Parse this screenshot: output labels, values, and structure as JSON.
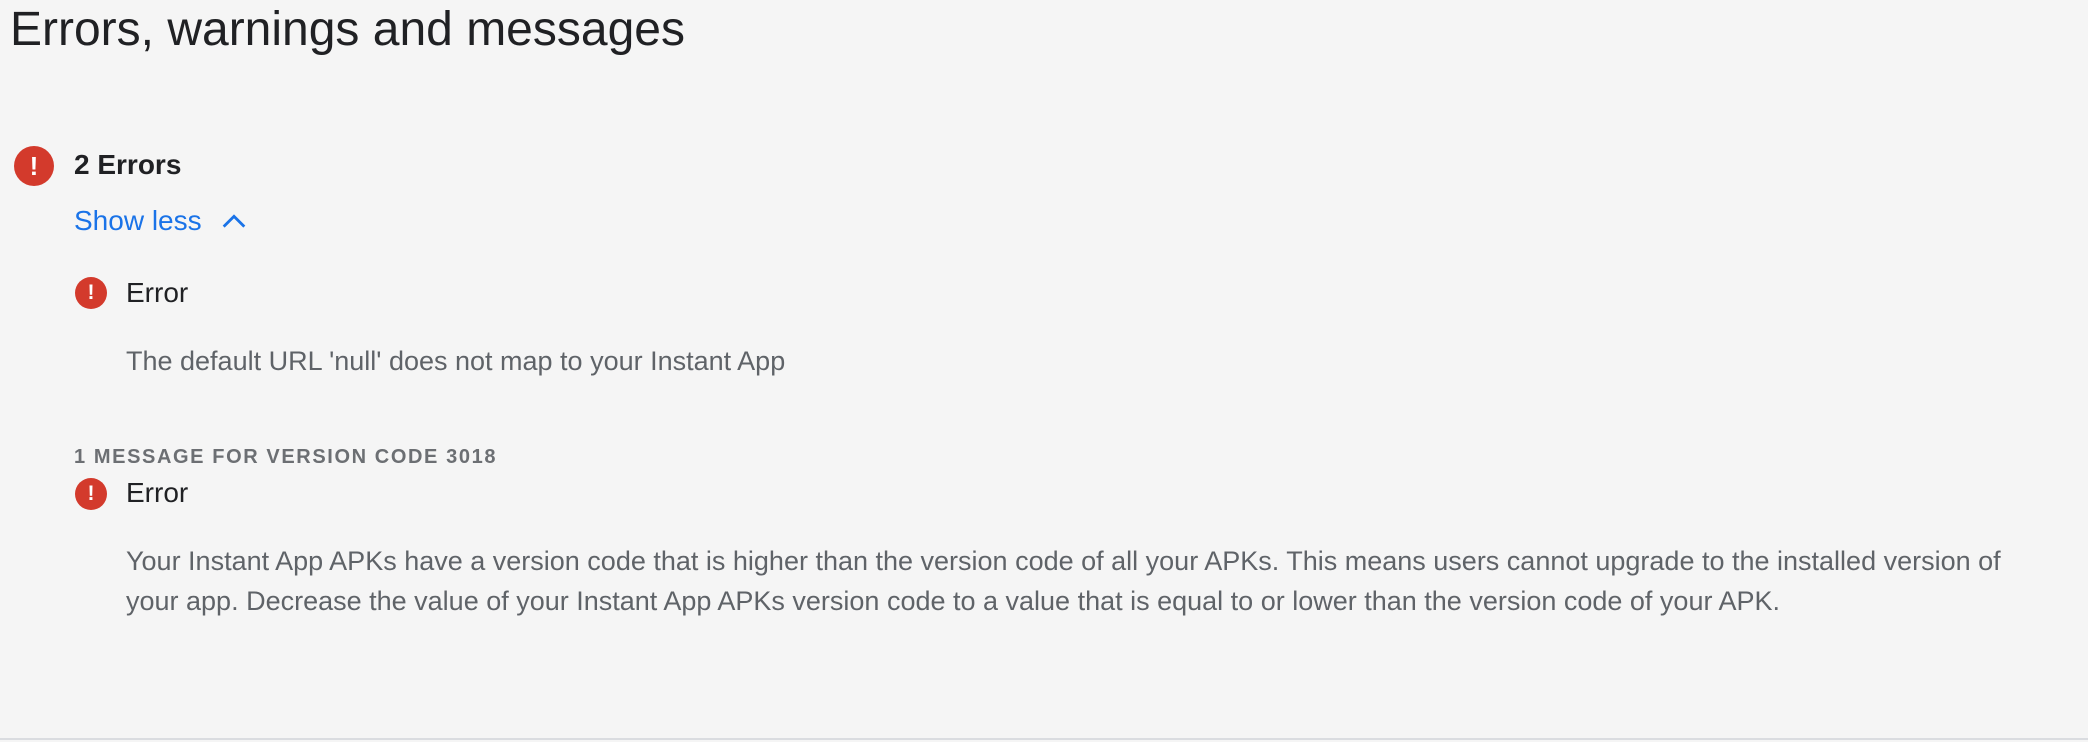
{
  "page": {
    "title": "Errors, warnings and messages"
  },
  "summary": {
    "errors_count_label": "2 Errors",
    "toggle_label": "Show less",
    "icon": "error-icon"
  },
  "errors": [
    {
      "title": "Error",
      "description": "The default URL 'null' does not map to your Instant App"
    }
  ],
  "version_section": {
    "header": "1 MESSAGE FOR VERSION CODE 3018",
    "items": [
      {
        "title": "Error",
        "description": "Your Instant App APKs have a version code that is higher than the version code of all your APKs. This means users cannot upgrade to the installed version of your app. Decrease the value of your Instant App APKs version code to a value that is equal to or lower than the version code of your APK."
      }
    ]
  },
  "colors": {
    "error": "#d33a2c",
    "link": "#1a73e8",
    "text_primary": "#202124",
    "text_secondary": "#5f6368",
    "background": "#f5f5f5"
  }
}
